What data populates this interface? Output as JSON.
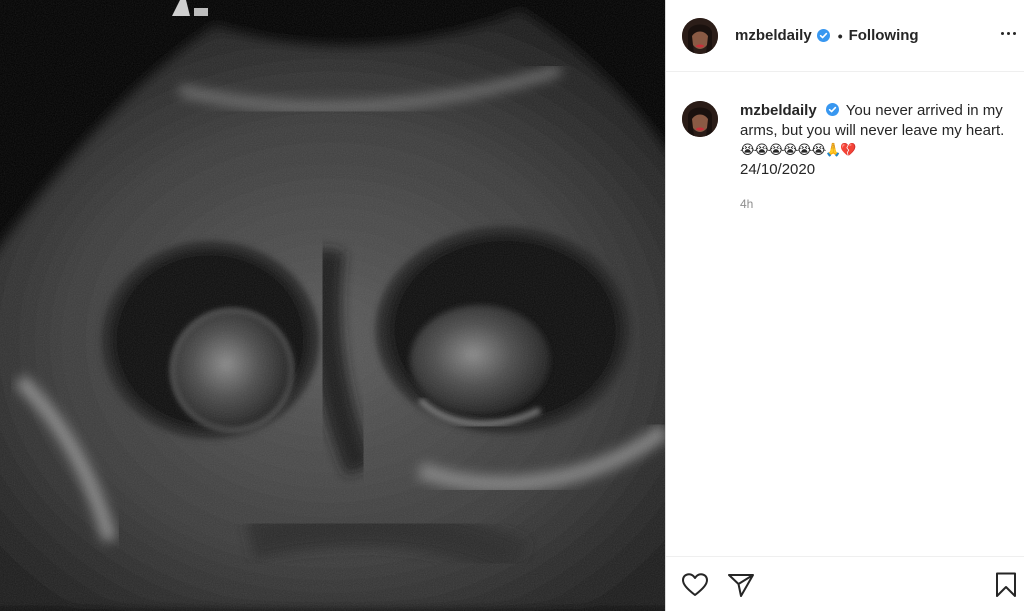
{
  "post": {
    "username": "mzbeldaily",
    "follow_status": "Following",
    "separator": "•",
    "caption_text": "You never arrived in my arms, but you will never leave my heart.",
    "caption_emojis": "😭😭😭😭😭😭🙏💔",
    "caption_date": "24/10/2020",
    "time_ago": "4h"
  },
  "icons": {
    "verified": "verified-badge-icon",
    "more": "more-options-icon",
    "like": "heart-icon",
    "share": "paper-plane-icon",
    "save": "bookmark-icon"
  },
  "colors": {
    "verified_blue": "#3897f0",
    "text": "#262626",
    "muted": "#8e8e8e",
    "divider": "#efefef"
  }
}
